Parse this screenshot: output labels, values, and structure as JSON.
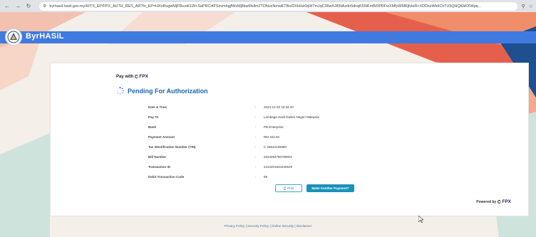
{
  "browser": {
    "url": "byrhasil.hasil.gov.my/HITS_EP/FPX_AUTH_RES_AR?fn_EP=HXoRugwMjF0kuoKLW+SaPRCi4FSirvmhgjfWzMj8kwMsllm2TONuzNmwETBs/DXkHzi0qW7mJqC36wXJi5NAzdn5dnqK55tKmB/0PRFwXMfyWMRjfcleR+XDOxxWb6CkTU5QHQKbKXWpq...",
    "icons": [
      "back-arrow-icon",
      "forward-arrow-icon",
      "reload-icon",
      "site-info-icon",
      "zoom-icon",
      "star-icon"
    ]
  },
  "header": {
    "brand": "ByrHASiL",
    "accent_color": "#3f7ae0"
  },
  "card": {
    "pay_with_label": "Pay with",
    "fpx_label": "FPX",
    "status_title": "Pending For Authorization",
    "status_color": "#1e66b0",
    "rows": [
      {
        "label": "Date & Time",
        "value": "2024-12-20 16:34:33"
      },
      {
        "label": "Pay To",
        "value": "Lembaga Hasil Dalam Negeri Malaysia"
      },
      {
        "label": "Bank",
        "value": "PB Enterprise"
      },
      {
        "label": "Payment Amount",
        "value": "RM 342.92"
      },
      {
        "label": "Tax Identification Number (TIN)",
        "value": "C 26542225080"
      },
      {
        "label": "Bill Number",
        "value": "2024094780708001"
      },
      {
        "label": "Transaction ID",
        "value": "2412201634340629"
      },
      {
        "label": "Debit Transaction Code",
        "value": "99"
      }
    ],
    "print_label": "Print",
    "another_payment_label": "Make Another Payment?",
    "powered_by_label": "Powered by",
    "button_color": "#1992b8"
  },
  "footer": {
    "text": "Privacy Policy | Security Policy | Online Security | Disclaimer"
  }
}
